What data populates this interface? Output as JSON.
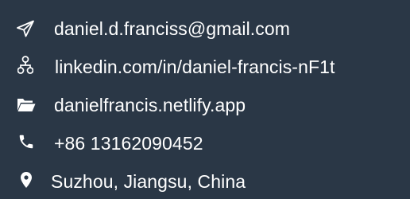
{
  "background_color": "#2a3746",
  "text_color": "#ffffff",
  "contacts": {
    "email": {
      "icon": "send-icon",
      "text": "daniel.d.franciss@gmail.com"
    },
    "linkedin": {
      "icon": "network-icon",
      "text": "linkedin.com/in/daniel-francis-nF1t"
    },
    "website": {
      "icon": "folder-icon",
      "text": "danielfrancis.netlify.app"
    },
    "phone": {
      "icon": "phone-icon",
      "text": "+86 13162090452"
    },
    "location": {
      "icon": "map-pin-icon",
      "text": "Suzhou, Jiangsu, China"
    }
  }
}
